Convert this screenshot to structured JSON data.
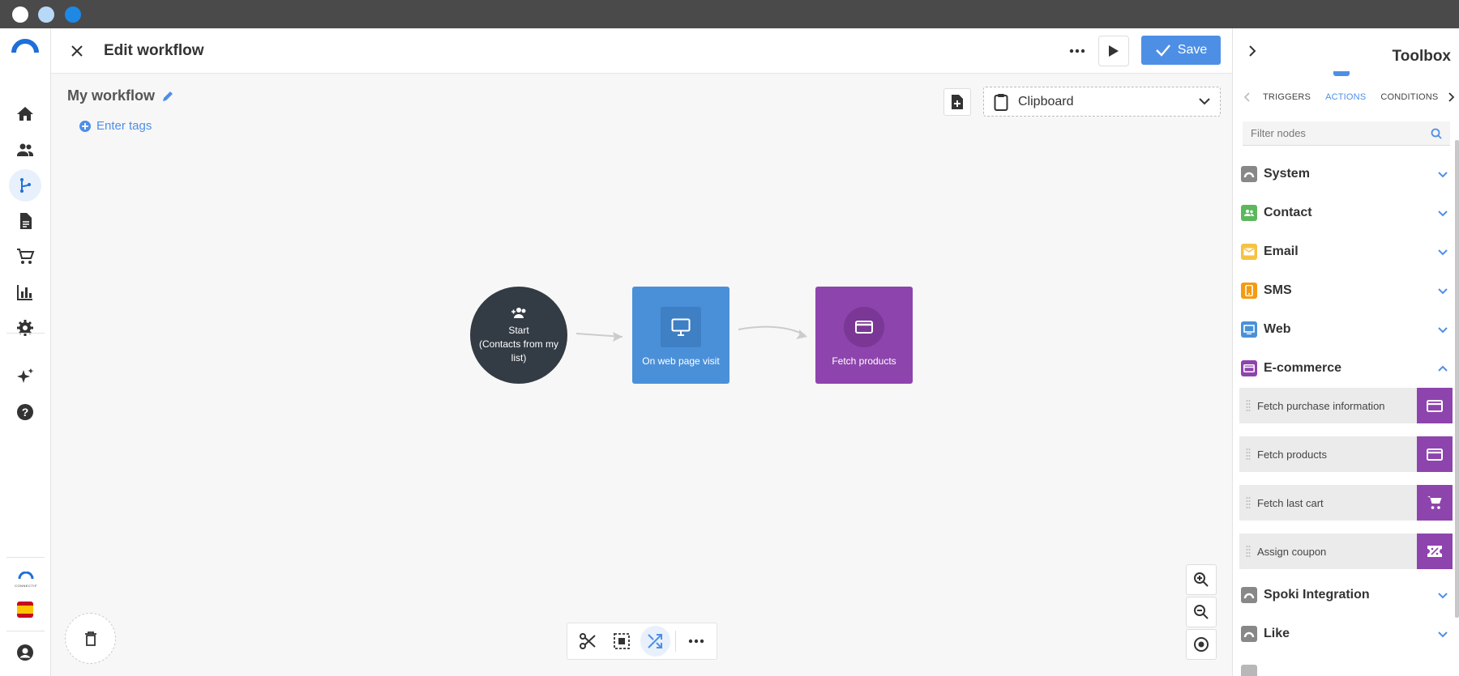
{
  "window": {
    "dots": [
      "#ffffff",
      "#b8d8f8",
      "#1e88e5"
    ]
  },
  "sidebar": {
    "items": [
      {
        "icon": "home-icon"
      },
      {
        "icon": "contacts-icon"
      },
      {
        "icon": "workflow-icon"
      },
      {
        "icon": "document-icon"
      },
      {
        "icon": "cart-icon"
      },
      {
        "icon": "chart-icon"
      },
      {
        "icon": "gear-icon"
      },
      {
        "icon": "sparkles-icon"
      },
      {
        "icon": "help-icon"
      }
    ],
    "brand_text": "CONNECTIF",
    "language_flag": "es",
    "account_icon": "account-icon"
  },
  "header": {
    "title": "Edit workflow",
    "save_label": "Save"
  },
  "workflow": {
    "name": "My workflow",
    "tags_label": "Enter tags",
    "clipboard_label": "Clipboard",
    "nodes": [
      {
        "label_line1": "Start",
        "label_line2": "(Contacts from my list)",
        "icon": "contacts-add-icon"
      },
      {
        "label": "On web page visit",
        "icon": "monitor-icon",
        "color": "#4a90d9"
      },
      {
        "label": "Fetch products",
        "icon": "credit-card-icon",
        "color": "#8e44ad"
      }
    ]
  },
  "toolbox": {
    "title": "Toolbox",
    "tabs": [
      "TRIGGERS",
      "ACTIONS",
      "CONDITIONS"
    ],
    "active_tab": "ACTIONS",
    "filter_placeholder": "Filter nodes",
    "categories": [
      {
        "label": "System",
        "color": "#888888",
        "expanded": false
      },
      {
        "label": "Contact",
        "color": "#5cb85c",
        "expanded": false
      },
      {
        "label": "Email",
        "color": "#f5c242",
        "expanded": false
      },
      {
        "label": "SMS",
        "color": "#f39c12",
        "expanded": false
      },
      {
        "label": "Web",
        "color": "#4a90d9",
        "expanded": false
      },
      {
        "label": "E-commerce",
        "color": "#8e44ad",
        "expanded": true
      },
      {
        "label": "Spoki Integration",
        "color": "#888888",
        "expanded": false
      },
      {
        "label": "Like",
        "color": "#888888",
        "expanded": false
      }
    ],
    "ecommerce_actions": [
      {
        "label": "Fetch purchase information",
        "icon": "credit-card-icon"
      },
      {
        "label": "Fetch products",
        "icon": "credit-card-icon"
      },
      {
        "label": "Fetch last cart",
        "icon": "cart-icon"
      },
      {
        "label": "Assign coupon",
        "icon": "coupon-icon"
      }
    ]
  }
}
